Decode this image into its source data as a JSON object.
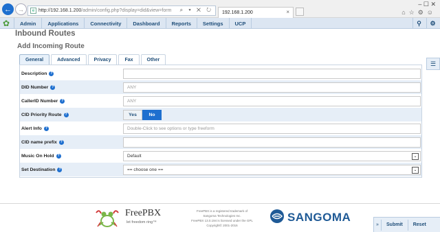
{
  "browser": {
    "url_host": "http://192.168.1.200",
    "url_path": "/admin/config.php?display=did&view=form",
    "tab_title": "192.168.1.200",
    "tab_close": "×",
    "window_controls": "–  ☐  ✕"
  },
  "menu": {
    "items": [
      {
        "label": "Admin"
      },
      {
        "label": "Applications"
      },
      {
        "label": "Connectivity"
      },
      {
        "label": "Dashboard"
      },
      {
        "label": "Reports"
      },
      {
        "label": "Settings"
      },
      {
        "label": "UCP"
      }
    ]
  },
  "page": {
    "title": "Inbound Routes",
    "section": "Add Incoming Route"
  },
  "tabs": [
    {
      "label": "General",
      "active": true
    },
    {
      "label": "Advanced"
    },
    {
      "label": "Privacy"
    },
    {
      "label": "Fax"
    },
    {
      "label": "Other"
    }
  ],
  "form": {
    "description": {
      "label": "Description",
      "value": ""
    },
    "did_number": {
      "label": "DID Number",
      "placeholder": "ANY"
    },
    "callerid_number": {
      "label": "CallerID Number",
      "placeholder": "ANY"
    },
    "cid_priority": {
      "label": "CID Priority Route",
      "yes": "Yes",
      "no": "No",
      "selected": "No"
    },
    "alert_info": {
      "label": "Alert Info",
      "placeholder": "Double-Click to see options or type freeform"
    },
    "cid_name_prefix": {
      "label": "CID name prefix",
      "value": ""
    },
    "music_on_hold": {
      "label": "Music On Hold",
      "value": "Default"
    },
    "set_destination": {
      "label": "Set Destination",
      "value": "== choose one =="
    },
    "help_glyph": "?"
  },
  "footer": {
    "freepbx_name": "FreePBX",
    "freepbx_tag": "let freedom ring™",
    "legal_1": "FreePBX is a registered trademark of",
    "legal_2": "Sangoma Technologies Inc.",
    "legal_3": "FreePBX 13.0.194 is licensed under the GPL",
    "legal_4": "Copyright© 2001-2016",
    "sangoma": "SANGOMA"
  },
  "actions": {
    "arrow": "»",
    "submit": "Submit",
    "reset": "Reset"
  },
  "colors": {
    "accent": "#1e6fcf",
    "nav_text": "#1f4e79",
    "nav_bg": "#dce6f2",
    "row_shade": "#e6eef7"
  }
}
